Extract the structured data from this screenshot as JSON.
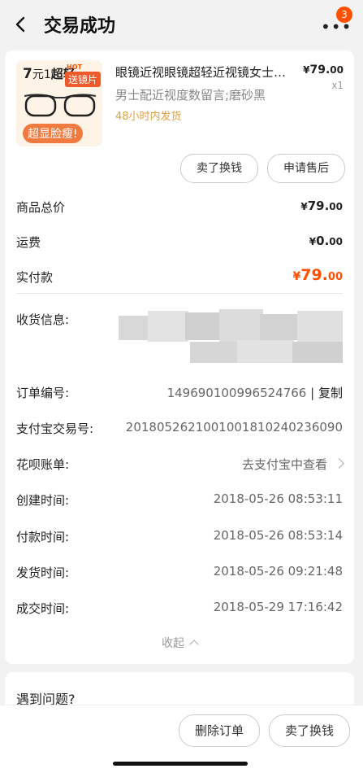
{
  "header": {
    "title": "交易成功",
    "badge_count": "3",
    "back_icon": "chevron-left-icon",
    "more_icon": "more-dots-icon"
  },
  "product": {
    "name": "眼镜近视眼镜超轻近视镜女士框架男款防辐射眼镜",
    "price_symbol": "¥",
    "price_int": "79.",
    "price_dec": "00",
    "quantity": "x1",
    "sku": "男士配近视度数留言;磨砂黑",
    "ship_note": "48小时内发货",
    "thumb": {
      "promo_num": "7",
      "promo_small": "元",
      "promo_1": "1",
      "promo_word": "超轻",
      "hot": "HOT",
      "tag": "送镜片",
      "slogan": "超显脸瘦!"
    }
  },
  "actions": {
    "sell_label": "卖了换钱",
    "after_sale_label": "申请售后"
  },
  "summary": {
    "total_label": "商品总价",
    "total_int": "79.",
    "total_dec": "00",
    "shipping_label": "运费",
    "shipping_int": "0.",
    "shipping_dec": "00",
    "paid_label": "实付款",
    "paid_int": "79.",
    "paid_dec": "00",
    "currency": "¥"
  },
  "details": {
    "address_label": "收货信息:",
    "order_no_label": "订单编号:",
    "order_no": "149690100996524766",
    "copy_sep": "|",
    "copy_label": "复制",
    "alipay_label": "支付宝交易号:",
    "alipay_no": "2018052621001001810240236090",
    "huabei_label": "花呗账单:",
    "huabei_value": "去支付宝中查看",
    "created_label": "创建时间:",
    "created": "2018-05-26 08:53:11",
    "paid_label": "付款时间:",
    "paid": "2018-05-26 08:53:14",
    "shipped_label": "发货时间:",
    "shipped": "2018-05-26 09:21:48",
    "closed_label": "成交时间:",
    "closed": "2018-05-29 17:16:42",
    "collapse_label": "收起"
  },
  "help": {
    "title": "遇到问题?"
  },
  "bottom": {
    "delete_label": "删除订单",
    "sell_label": "卖了换钱"
  },
  "colors": {
    "accent": "#ff5000",
    "ship_note": "#e0a040"
  }
}
